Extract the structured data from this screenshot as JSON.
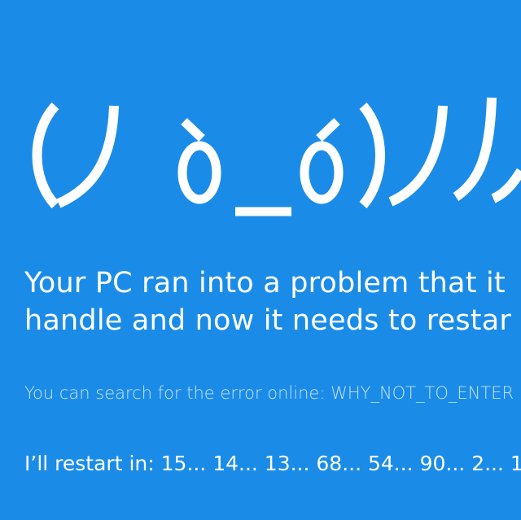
{
  "screen": {
    "background_color": "#1a8ce8",
    "text_color": "#ffffff",
    "emoticon": "(ノò_ó)ノ",
    "message_lines": [
      "Your PC ran into a problem that it",
      "handle and now it needs to restar"
    ],
    "search_text": "You can search for the error online: WHY_NOT_TO_ENTER",
    "restart_text": "I’ll restart in: 15... 14... 13... 68... 54... 90... 2... 1."
  }
}
